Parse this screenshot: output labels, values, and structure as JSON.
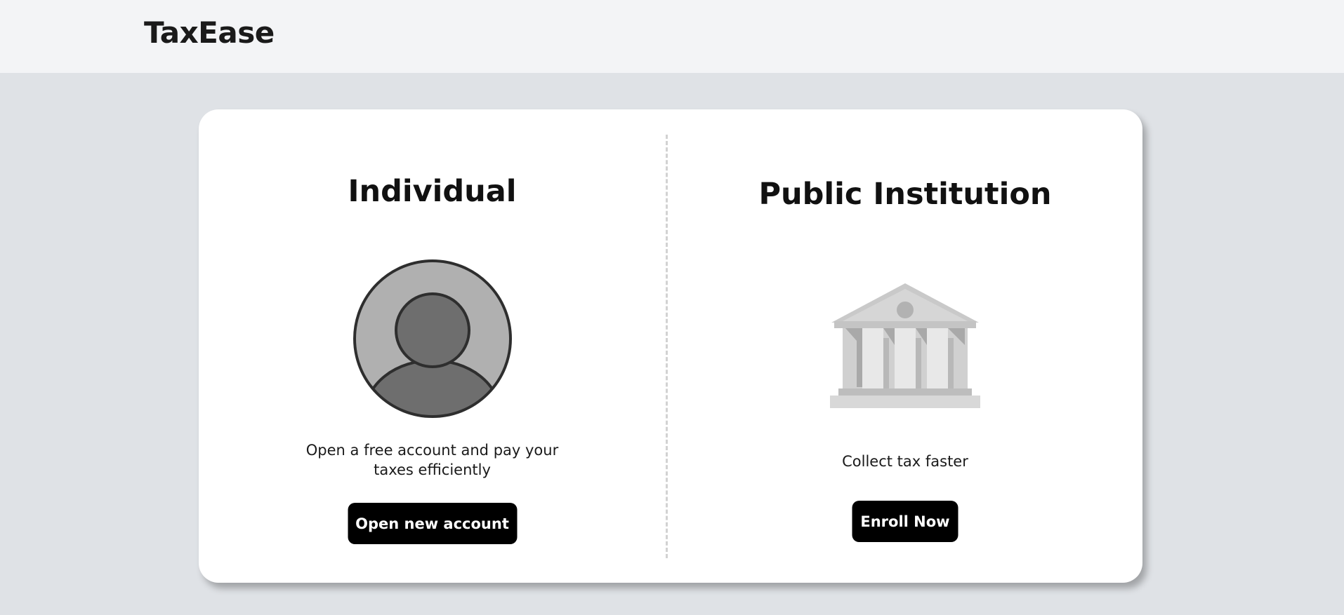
{
  "header": {
    "brand": "TaxEase"
  },
  "options": {
    "individual": {
      "title": "Individual",
      "icon": "user-avatar-icon",
      "description": "Open a free account and pay your taxes efficiently",
      "button_label": "Open new account"
    },
    "institution": {
      "title": "Public Institution",
      "icon": "bank-building-icon",
      "description": "Collect tax faster",
      "button_label": "Enroll Now"
    }
  },
  "colors": {
    "page_background": "#dfe2e6",
    "header_background": "#f3f4f6",
    "card_background": "#ffffff",
    "button_background": "#000000",
    "button_text": "#ffffff",
    "divider": "#d2d2d2"
  }
}
